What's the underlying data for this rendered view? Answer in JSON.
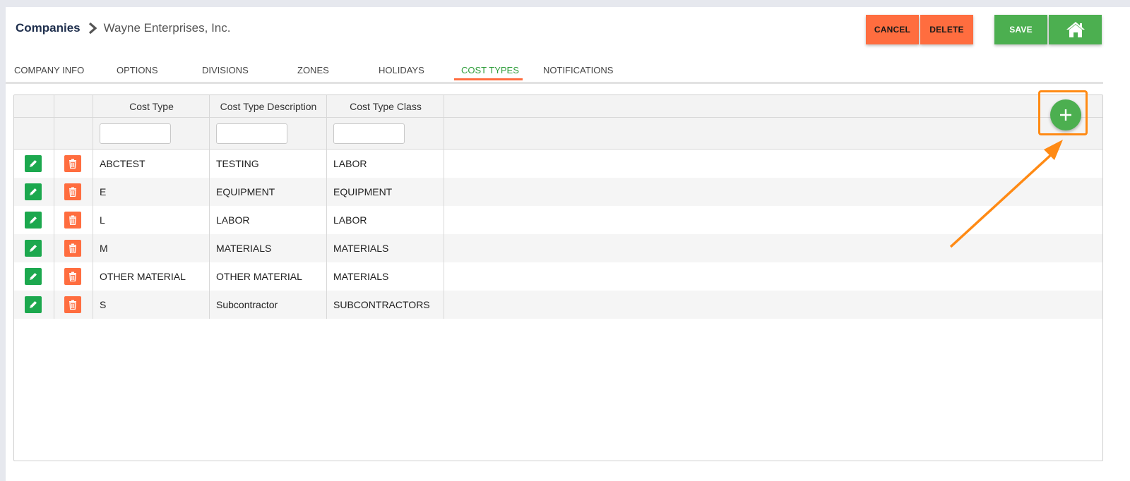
{
  "breadcrumb": {
    "root": "Companies",
    "current": "Wayne Enterprises, Inc."
  },
  "actions": {
    "cancel": "CANCEL",
    "delete": "DELETE",
    "save": "SAVE",
    "home_icon": "home-icon"
  },
  "tabs": [
    {
      "label": "COMPANY INFO",
      "active": false
    },
    {
      "label": "OPTIONS",
      "active": false
    },
    {
      "label": "DIVISIONS",
      "active": false
    },
    {
      "label": "ZONES",
      "active": false
    },
    {
      "label": "HOLIDAYS",
      "active": false
    },
    {
      "label": "COST TYPES",
      "active": true
    },
    {
      "label": "NOTIFICATIONS",
      "active": false
    }
  ],
  "table": {
    "columns": [
      "Cost Type",
      "Cost Type Description",
      "Cost Type Class"
    ],
    "filters": [
      "",
      "",
      ""
    ],
    "rows": [
      {
        "cost_type": "ABCTEST",
        "description": "TESTING",
        "class": "LABOR"
      },
      {
        "cost_type": "E",
        "description": "EQUIPMENT",
        "class": "EQUIPMENT"
      },
      {
        "cost_type": "L",
        "description": "LABOR",
        "class": "LABOR"
      },
      {
        "cost_type": "M",
        "description": "MATERIALS",
        "class": "MATERIALS"
      },
      {
        "cost_type": "OTHER MATERIAL",
        "description": "OTHER MATERIAL",
        "class": "MATERIALS"
      },
      {
        "cost_type": "S",
        "description": "Subcontractor",
        "class": "SUBCONTRACTORS"
      }
    ]
  },
  "colors": {
    "accent_orange": "#ff6d3f",
    "accent_green": "#4caf50",
    "edit_green": "#1ca84e",
    "active_tab": "#2e9d3a",
    "annotation": "#ff8a14"
  }
}
